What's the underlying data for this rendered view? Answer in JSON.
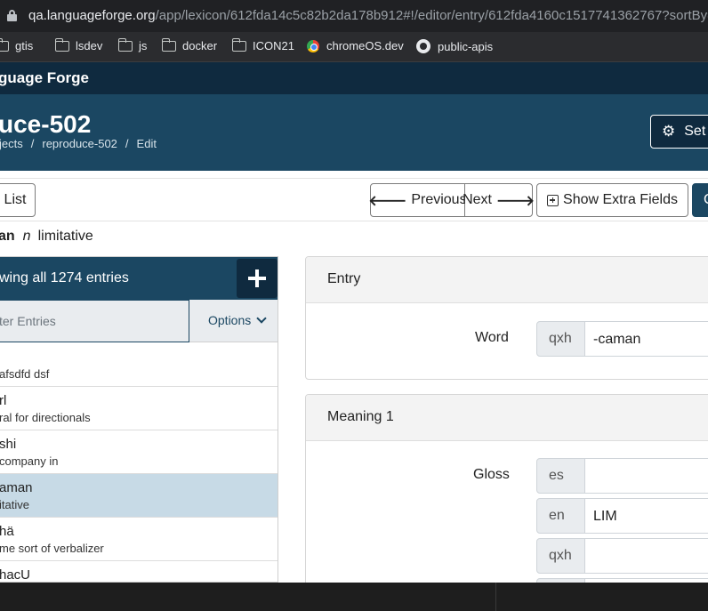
{
  "browser": {
    "url_host": "qa.languageforge.org",
    "url_path": "/app/lexicon/612fda14c5c82b2da178b912#!/editor/entry/612fda4160c1517741362767?sortBy=",
    "bookmarks": [
      {
        "label": "gtis",
        "icon": "folder-icon"
      },
      {
        "label": "lsdev",
        "icon": "folder-icon"
      },
      {
        "label": "js",
        "icon": "folder-icon"
      },
      {
        "label": "docker",
        "icon": "folder-icon"
      },
      {
        "label": "ICON21",
        "icon": "folder-icon"
      },
      {
        "label": "chromeOS.dev",
        "icon": "chromeos-icon"
      },
      {
        "label": "public-apis",
        "icon": "github-icon"
      }
    ]
  },
  "app": {
    "brand": "guage Forge"
  },
  "project": {
    "title": "uce-502",
    "breadcrumbs": [
      "jects",
      "reproduce-502",
      "Edit"
    ],
    "settings_label": "Set"
  },
  "toolbar": {
    "list_label": "List",
    "previous_label": "Previous",
    "next_label": "Next",
    "extra_fields_label": "Show Extra Fields",
    "dark_label": "C"
  },
  "entry_summary": {
    "word": "an",
    "pos": "n",
    "gloss": "limitative"
  },
  "list": {
    "header": "wing all 1274 entries",
    "filter_placeholder": "ter Entries",
    "options_label": "Options",
    "entries": [
      {
        "word": "",
        "gloss": "afsdfd dsf",
        "selected": false
      },
      {
        "word": "rl",
        "gloss": "ral for directionals",
        "selected": false
      },
      {
        "word": "shi",
        "gloss": "company in",
        "selected": false
      },
      {
        "word": "aman",
        "gloss": "itative",
        "selected": true
      },
      {
        "word": "hä",
        "gloss": "me sort of verbalizer",
        "selected": false
      },
      {
        "word": "hacU",
        "gloss": "",
        "selected": false
      }
    ]
  },
  "editor": {
    "entry_section": {
      "title": "Entry",
      "word_label": "Word",
      "word_ws": "qxh",
      "word_value": "-caman"
    },
    "meaning_section": {
      "title": "Meaning 1",
      "gloss_label": "Gloss",
      "glosses": [
        {
          "ws": "es",
          "value": ""
        },
        {
          "ws": "en",
          "value": "LIM"
        },
        {
          "ws": "qxh",
          "value": ""
        }
      ]
    }
  },
  "colors": {
    "navbar": "#0f2a3f",
    "header": "#1b4762",
    "selected_row": "#c7dae6"
  }
}
